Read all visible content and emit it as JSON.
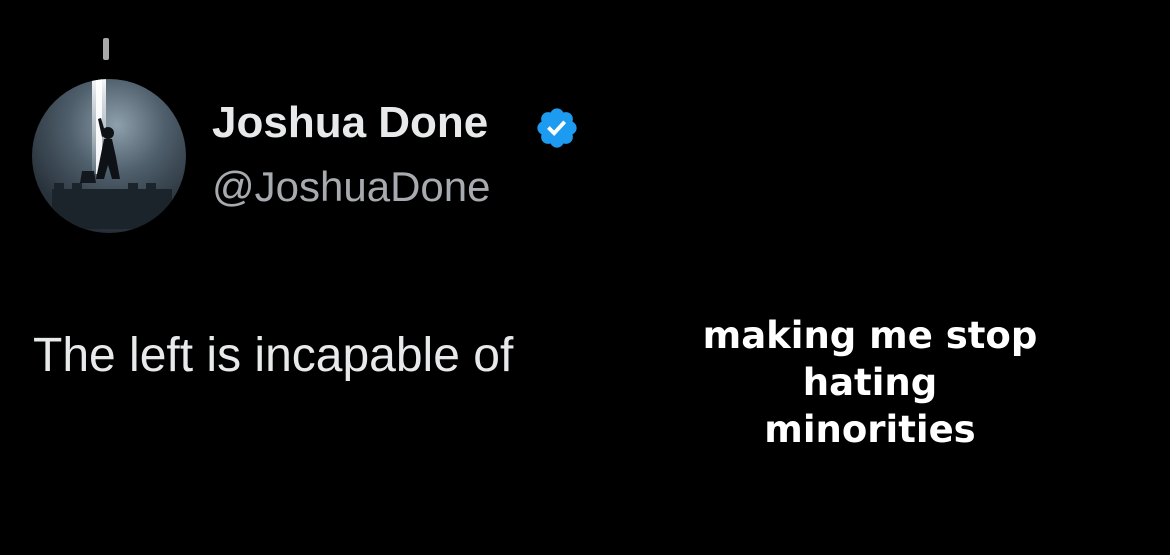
{
  "tweet": {
    "display_name": "Joshua Done",
    "handle": "@JoshuaDone",
    "verified": true,
    "verified_icon": "verified-badge-icon",
    "text": "The left is incapable of"
  },
  "caption": {
    "line1": "making me stop hating",
    "line2": "minorities"
  },
  "colors": {
    "background": "#000000",
    "primary_text": "#e7e9ea",
    "secondary_text": "#a7abb0",
    "verified_blue": "#1d9bf0",
    "caption_text": "#ffffff"
  }
}
